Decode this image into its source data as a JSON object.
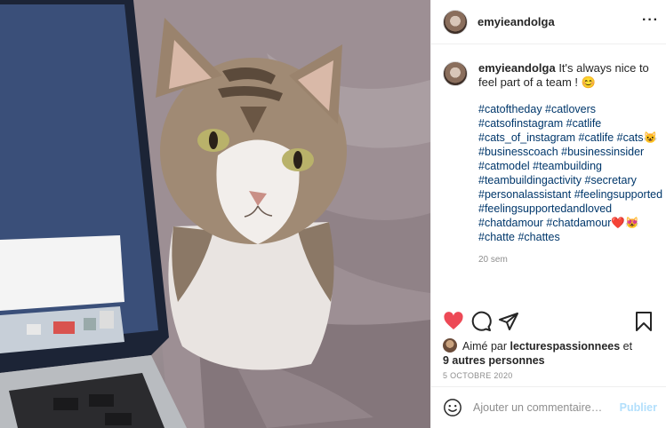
{
  "post": {
    "username": "emyieandolga",
    "more_label": "···",
    "caption": {
      "username": "emyieandolga",
      "text": " It's always nice to feel part of a team ! 😊",
      "hashtag_lines": [
        "#catoftheday #catlovers",
        "#catsofinstagram #catlife",
        "#cats_of_instagram #catlife #cats😺",
        "#businesscoach #businessinsider",
        "#catmodel #teambuilding",
        "#teambuildingactivity #secretary",
        "#personalassistant #feelingsupported",
        "#feelingsupportedandloved",
        "#chatdamour #chatdamour❤️😻",
        "#chatte #chattes"
      ],
      "age": "20 sem"
    },
    "likes": {
      "prefix": "Aimé par ",
      "user": "lecturespassionnees",
      "joiner": " et",
      "others": "9 autres personnes"
    },
    "date": "5 OCTOBRE 2020",
    "comment": {
      "placeholder": "Ajouter un commentaire…",
      "publish": "Publier"
    },
    "colors": {
      "like_red": "#ed4956",
      "hashtag_blue": "#00376b",
      "publish_disabled": "#b2dffc"
    },
    "icons": [
      "heart-icon",
      "comment-icon",
      "share-icon",
      "bookmark-icon",
      "emoji-icon"
    ]
  }
}
